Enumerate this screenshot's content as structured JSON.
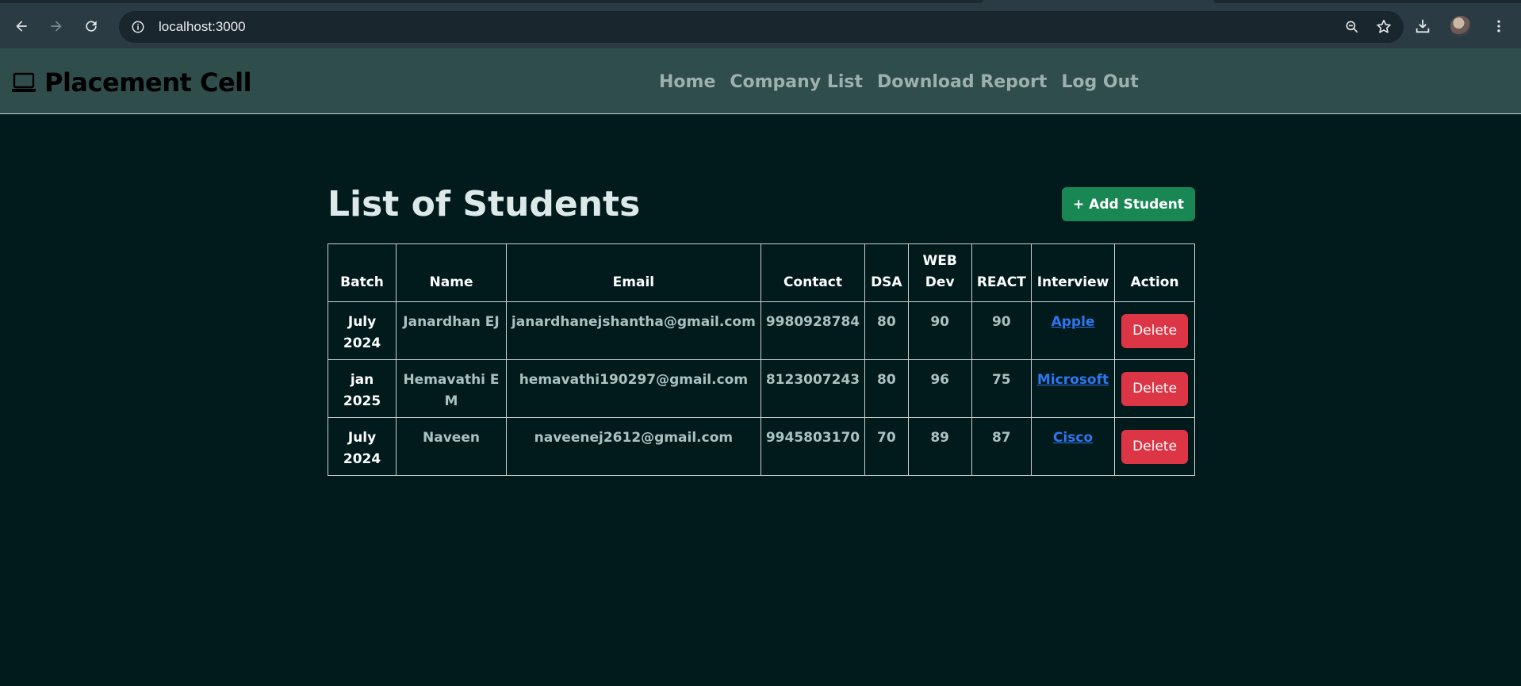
{
  "browser": {
    "url": "localhost:3000"
  },
  "navbar": {
    "brand": "Placement Cell",
    "links": [
      "Home",
      "Company List",
      "Download Report",
      "Log Out"
    ]
  },
  "main": {
    "title": "List of Students",
    "add_button": "+ Add Student",
    "table": {
      "headers": [
        "Batch",
        "Name",
        "Email",
        "Contact",
        "DSA",
        "WEB Dev",
        "REACT",
        "Interview",
        "Action"
      ],
      "rows": [
        {
          "batch": "July 2024",
          "name": "Janardhan EJ",
          "email": "janardhanejshantha@gmail.com",
          "contact": "9980928784",
          "dsa": "80",
          "web": "90",
          "react": "90",
          "interview": "Apple",
          "action": "Delete"
        },
        {
          "batch": "jan 2025",
          "name": "Hemavathi E M",
          "email": "hemavathi190297@gmail.com",
          "contact": "8123007243",
          "dsa": "80",
          "web": "96",
          "react": "75",
          "interview": "Microsoft",
          "action": "Delete"
        },
        {
          "batch": "July 2024",
          "name": "Naveen",
          "email": "naveenej2612@gmail.com",
          "contact": "9945803170",
          "dsa": "70",
          "web": "89",
          "react": "87",
          "interview": "Cisco",
          "action": "Delete"
        }
      ]
    }
  },
  "colors": {
    "background": "#011a1c",
    "navbar": "#2f4d4b",
    "add_button": "#198754",
    "delete_button": "#dc3545",
    "link": "#2e77f0"
  }
}
